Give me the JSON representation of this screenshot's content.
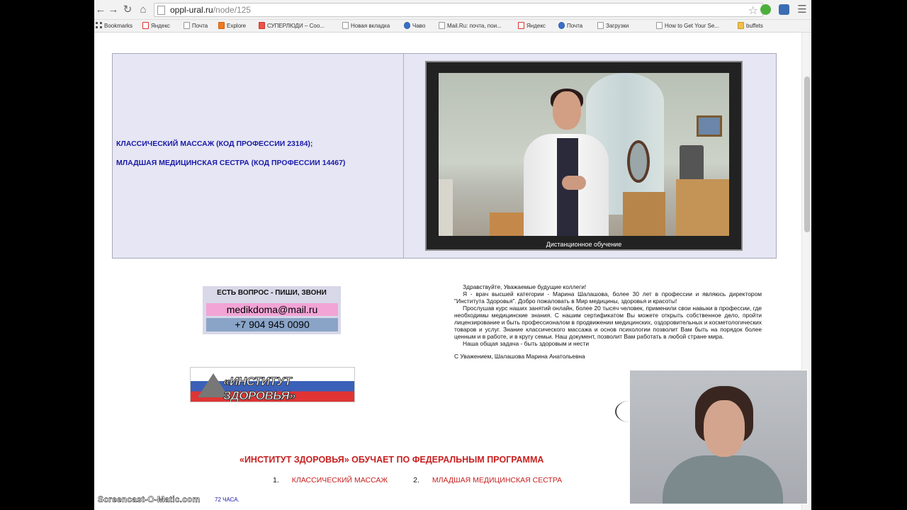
{
  "browser": {
    "url_host": "oppl-ural.ru",
    "url_path": "/node/125"
  },
  "bookmarks": [
    {
      "label": "Bookmarks",
      "icon": "apps"
    },
    {
      "label": "Яндекс",
      "icon": "ya"
    },
    {
      "label": "Почта",
      "icon": "page"
    },
    {
      "label": "Explore",
      "icon": "orange"
    },
    {
      "label": "СУПЕРЛЮДИ – Coo...",
      "icon": "red"
    },
    {
      "label": "Новая вкладка",
      "icon": "page"
    },
    {
      "label": "Чаво",
      "icon": "blue"
    },
    {
      "label": "Mail.Ru: почта, пои...",
      "icon": "page"
    },
    {
      "label": "Яндекс",
      "icon": "ya"
    },
    {
      "label": "Почта",
      "icon": "blue"
    },
    {
      "label": "Загрузки",
      "icon": "page"
    },
    {
      "label": "How to Get Your Se...",
      "icon": "page"
    },
    {
      "label": "buffets",
      "icon": "folder"
    }
  ],
  "banner": {
    "course1": "КЛАССИЧЕСКИЙ МАССАЖ (КОД ПРОФЕССИИ 23184);",
    "course2": "МЛАДШАЯ МЕДИЦИНСКАЯ СЕСТРА (КОД ПРОФЕССИИ 14467)",
    "video_caption": "Дистанционное обучение"
  },
  "contact": {
    "title": "ЕСТЬ ВОПРОС - ПИШИ, ЗВОНИ",
    "email": "medikdoma@mail.ru",
    "phone": "+7 904 945 0090"
  },
  "logo": {
    "text": "«ИНСТИТУТ ЗДОРОВЬЯ»"
  },
  "letter": {
    "greeting": "Здравствуйте, Уважаемые будущие коллеги!",
    "p1": "Я - врач высшей категории - Марина Шалашова, более 30 лет в профессии и являюсь директором \"Института Здоровья\". Добро пожаловать в Мир медицины, здоровья и красоты!",
    "p2": "Прослушав курс наших занятий онлайн, более 20 тысяч человек, применили свои навыки в профессии, где необходимы медицинские знания. С нашим сертификатом Вы можете открыть собственное дело, пройти лицензирование и быть профессионалом в продвижении медицинских, оздоровительных и косметологических товаров и услуг. Знание классического массажа и основ психологии позволит Вам быть на порядок более ценным и в работе, и в кругу семьи. Наш документ, позволит Вам работать в любой стране мира.",
    "p3": "Наша общая задача - быть здоровым и нести",
    "sign": "С Уважением, Шалашова Марина Анатольевна"
  },
  "bottom": {
    "heading": "«ИНСТИТУТ ЗДОРОВЬЯ» ОБУЧАЕТ ПО ФЕДЕРАЛЬНЫМ ПРОГРАММА",
    "prog1_num": "1.",
    "prog1": "КЛАССИЧЕСКИЙ МАССАЖ",
    "prog2_num": "2.",
    "prog2": "МЛАДШАЯ МЕДИЦИНСКАЯ СЕСТРА",
    "hours": "72 ЧАСА."
  },
  "watermark": "Screencast-O-Matic.com",
  "colors": {
    "course_blue": "#1a1aa8",
    "heading_red": "#c82020",
    "email_pink": "#f2a4d6",
    "phone_blue": "#8aa4c8",
    "banner_bg": "#e6e6f4"
  }
}
